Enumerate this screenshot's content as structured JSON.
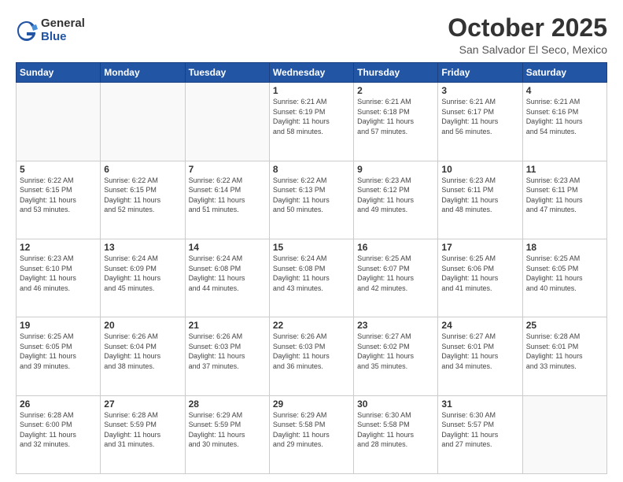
{
  "header": {
    "logo": {
      "general": "General",
      "blue": "Blue"
    },
    "title": "October 2025",
    "subtitle": "San Salvador El Seco, Mexico"
  },
  "weekdays": [
    "Sunday",
    "Monday",
    "Tuesday",
    "Wednesday",
    "Thursday",
    "Friday",
    "Saturday"
  ],
  "weeks": [
    [
      {
        "day": "",
        "info": ""
      },
      {
        "day": "",
        "info": ""
      },
      {
        "day": "",
        "info": ""
      },
      {
        "day": "1",
        "info": "Sunrise: 6:21 AM\nSunset: 6:19 PM\nDaylight: 11 hours\nand 58 minutes."
      },
      {
        "day": "2",
        "info": "Sunrise: 6:21 AM\nSunset: 6:18 PM\nDaylight: 11 hours\nand 57 minutes."
      },
      {
        "day": "3",
        "info": "Sunrise: 6:21 AM\nSunset: 6:17 PM\nDaylight: 11 hours\nand 56 minutes."
      },
      {
        "day": "4",
        "info": "Sunrise: 6:21 AM\nSunset: 6:16 PM\nDaylight: 11 hours\nand 54 minutes."
      }
    ],
    [
      {
        "day": "5",
        "info": "Sunrise: 6:22 AM\nSunset: 6:15 PM\nDaylight: 11 hours\nand 53 minutes."
      },
      {
        "day": "6",
        "info": "Sunrise: 6:22 AM\nSunset: 6:15 PM\nDaylight: 11 hours\nand 52 minutes."
      },
      {
        "day": "7",
        "info": "Sunrise: 6:22 AM\nSunset: 6:14 PM\nDaylight: 11 hours\nand 51 minutes."
      },
      {
        "day": "8",
        "info": "Sunrise: 6:22 AM\nSunset: 6:13 PM\nDaylight: 11 hours\nand 50 minutes."
      },
      {
        "day": "9",
        "info": "Sunrise: 6:23 AM\nSunset: 6:12 PM\nDaylight: 11 hours\nand 49 minutes."
      },
      {
        "day": "10",
        "info": "Sunrise: 6:23 AM\nSunset: 6:11 PM\nDaylight: 11 hours\nand 48 minutes."
      },
      {
        "day": "11",
        "info": "Sunrise: 6:23 AM\nSunset: 6:11 PM\nDaylight: 11 hours\nand 47 minutes."
      }
    ],
    [
      {
        "day": "12",
        "info": "Sunrise: 6:23 AM\nSunset: 6:10 PM\nDaylight: 11 hours\nand 46 minutes."
      },
      {
        "day": "13",
        "info": "Sunrise: 6:24 AM\nSunset: 6:09 PM\nDaylight: 11 hours\nand 45 minutes."
      },
      {
        "day": "14",
        "info": "Sunrise: 6:24 AM\nSunset: 6:08 PM\nDaylight: 11 hours\nand 44 minutes."
      },
      {
        "day": "15",
        "info": "Sunrise: 6:24 AM\nSunset: 6:08 PM\nDaylight: 11 hours\nand 43 minutes."
      },
      {
        "day": "16",
        "info": "Sunrise: 6:25 AM\nSunset: 6:07 PM\nDaylight: 11 hours\nand 42 minutes."
      },
      {
        "day": "17",
        "info": "Sunrise: 6:25 AM\nSunset: 6:06 PM\nDaylight: 11 hours\nand 41 minutes."
      },
      {
        "day": "18",
        "info": "Sunrise: 6:25 AM\nSunset: 6:05 PM\nDaylight: 11 hours\nand 40 minutes."
      }
    ],
    [
      {
        "day": "19",
        "info": "Sunrise: 6:25 AM\nSunset: 6:05 PM\nDaylight: 11 hours\nand 39 minutes."
      },
      {
        "day": "20",
        "info": "Sunrise: 6:26 AM\nSunset: 6:04 PM\nDaylight: 11 hours\nand 38 minutes."
      },
      {
        "day": "21",
        "info": "Sunrise: 6:26 AM\nSunset: 6:03 PM\nDaylight: 11 hours\nand 37 minutes."
      },
      {
        "day": "22",
        "info": "Sunrise: 6:26 AM\nSunset: 6:03 PM\nDaylight: 11 hours\nand 36 minutes."
      },
      {
        "day": "23",
        "info": "Sunrise: 6:27 AM\nSunset: 6:02 PM\nDaylight: 11 hours\nand 35 minutes."
      },
      {
        "day": "24",
        "info": "Sunrise: 6:27 AM\nSunset: 6:01 PM\nDaylight: 11 hours\nand 34 minutes."
      },
      {
        "day": "25",
        "info": "Sunrise: 6:28 AM\nSunset: 6:01 PM\nDaylight: 11 hours\nand 33 minutes."
      }
    ],
    [
      {
        "day": "26",
        "info": "Sunrise: 6:28 AM\nSunset: 6:00 PM\nDaylight: 11 hours\nand 32 minutes."
      },
      {
        "day": "27",
        "info": "Sunrise: 6:28 AM\nSunset: 5:59 PM\nDaylight: 11 hours\nand 31 minutes."
      },
      {
        "day": "28",
        "info": "Sunrise: 6:29 AM\nSunset: 5:59 PM\nDaylight: 11 hours\nand 30 minutes."
      },
      {
        "day": "29",
        "info": "Sunrise: 6:29 AM\nSunset: 5:58 PM\nDaylight: 11 hours\nand 29 minutes."
      },
      {
        "day": "30",
        "info": "Sunrise: 6:30 AM\nSunset: 5:58 PM\nDaylight: 11 hours\nand 28 minutes."
      },
      {
        "day": "31",
        "info": "Sunrise: 6:30 AM\nSunset: 5:57 PM\nDaylight: 11 hours\nand 27 minutes."
      },
      {
        "day": "",
        "info": ""
      }
    ]
  ]
}
